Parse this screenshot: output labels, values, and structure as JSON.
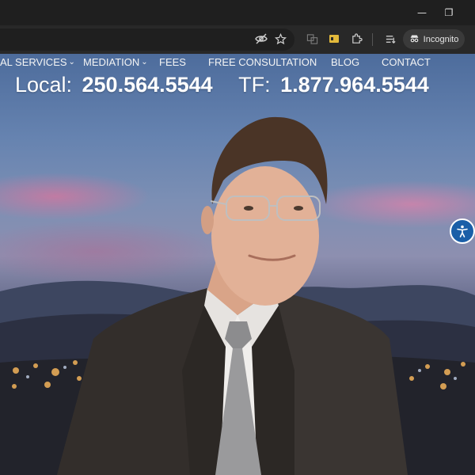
{
  "browser": {
    "window_controls": {
      "minimize": "—",
      "restore": "❐"
    },
    "incognito_label": "Incognito"
  },
  "nav": {
    "items": [
      {
        "label": "AL SERVICES",
        "has_dropdown": true
      },
      {
        "label": "MEDIATION",
        "has_dropdown": true
      },
      {
        "label": "FEES",
        "has_dropdown": false
      },
      {
        "label": "FREE CONSULTATION",
        "has_dropdown": false
      },
      {
        "label": "BLOG",
        "has_dropdown": false
      },
      {
        "label": "CONTACT",
        "has_dropdown": false
      }
    ]
  },
  "phones": {
    "local_label": "Local:",
    "local_number": "250.564.5544",
    "tollfree_label": "TF:",
    "tollfree_number": "1.877.964.5544"
  },
  "colors": {
    "accessibility_button": "#1a5fa8",
    "nav_text": "#f4f4f4",
    "chrome_bg": "#1f1f1f"
  }
}
